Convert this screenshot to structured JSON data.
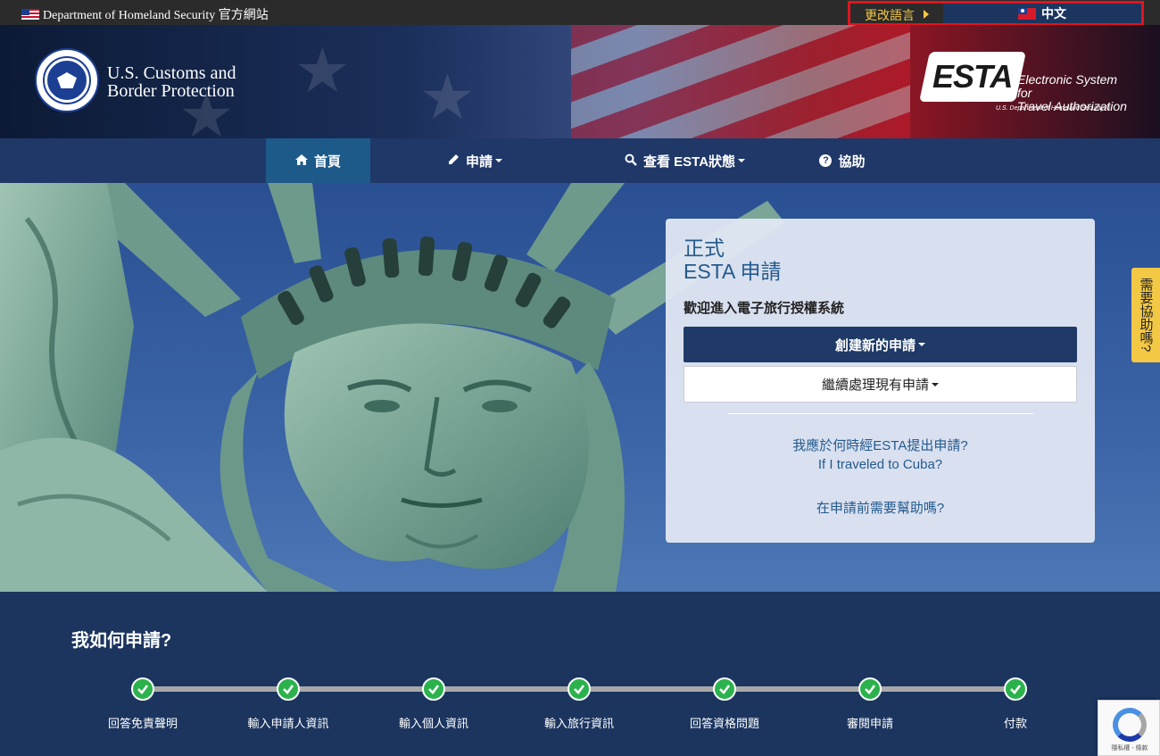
{
  "topbar": {
    "official_text": "Department of Homeland Security 官方網站",
    "change_language_label": "更改語言",
    "current_language": "中文"
  },
  "header": {
    "agency_line1": "U.S. Customs and",
    "agency_line2": "Border Protection",
    "esta_mark": "ESTA",
    "esta_line1": "Electronic System for",
    "esta_line2": "Travel Authorization",
    "esta_dhs": "U.S. Department of Homeland Security ®"
  },
  "nav": {
    "items": [
      {
        "label": "首頁",
        "icon": "home-icon"
      },
      {
        "label": "申請",
        "icon": "pencil-icon"
      },
      {
        "label": "查看 ESTA狀態",
        "icon": "search-icon"
      },
      {
        "label": "協助",
        "icon": "question-circle-icon"
      }
    ]
  },
  "card": {
    "title_line1": "正式",
    "title_line2": "ESTA 申請",
    "welcome": "歡迎進入電子旅行授權系統",
    "new_application": "創建新的申請",
    "continue_application": "繼續處理現有申請",
    "link_when": "我應於何時經ESTA提出申請?",
    "link_cuba": "If I traveled to Cuba?",
    "link_help": "在申請前需要幫助嗎?"
  },
  "side_help": "需要協助嗎?",
  "steps": {
    "heading": "我如何申請?",
    "items": [
      "回答免責聲明",
      "輸入申請人資訊",
      "輸入個人資訊",
      "輸入旅行資訊",
      "回答資格問題",
      "審閱申請",
      "付款"
    ]
  },
  "recaptcha": {
    "text": "隱私權 - 條款"
  },
  "colors": {
    "navy": "#1b355f",
    "nav_active": "#1d5a8a",
    "accent_yellow": "#f3c845",
    "step_green": "#2bb24c",
    "highlight_red": "#e0141e"
  }
}
